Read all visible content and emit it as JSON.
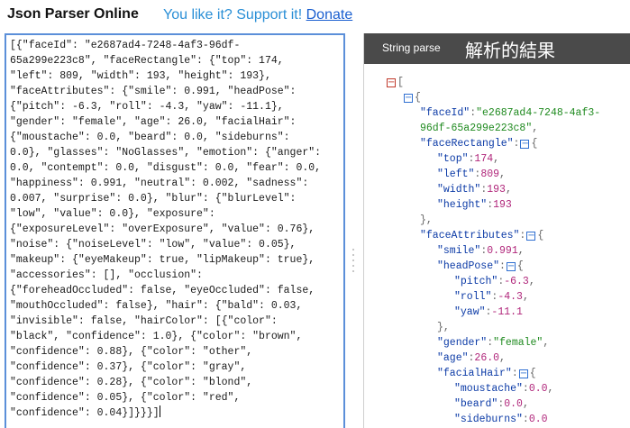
{
  "header": {
    "title": "Json Parser Online",
    "support_text": "You like it? Support it!",
    "donate_label": "Donate"
  },
  "input": {
    "lines": [
      "[{\"faceId\": \"e2687ad4-7248-4af3-96df-",
      "65a299e223c8\", \"faceRectangle\": {\"top\": 174,",
      "\"left\": 809, \"width\": 193, \"height\": 193},",
      "\"faceAttributes\": {\"smile\": 0.991, \"headPose\":",
      "{\"pitch\": -6.3, \"roll\": -4.3, \"yaw\": -11.1},",
      "\"gender\": \"female\", \"age\": 26.0, \"facialHair\":",
      "{\"moustache\": 0.0, \"beard\": 0.0, \"sideburns\":",
      "0.0}, \"glasses\": \"NoGlasses\", \"emotion\": {\"anger\":",
      "0.0, \"contempt\": 0.0, \"disgust\": 0.0, \"fear\": 0.0,",
      "\"happiness\": 0.991, \"neutral\": 0.002, \"sadness\":",
      "0.007, \"surprise\": 0.0}, \"blur\": {\"blurLevel\":",
      "\"low\", \"value\": 0.0}, \"exposure\":",
      "{\"exposureLevel\": \"overExposure\", \"value\": 0.76},",
      "\"noise\": {\"noiseLevel\": \"low\", \"value\": 0.05},",
      "\"makeup\": {\"eyeMakeup\": true, \"lipMakeup\": true},",
      "\"accessories\": [], \"occlusion\":",
      "{\"foreheadOccluded\": false, \"eyeOccluded\": false,",
      "\"mouthOccluded\": false}, \"hair\": {\"bald\": 0.03,",
      "\"invisible\": false, \"hairColor\": [{\"color\":",
      "\"black\", \"confidence\": 1.0}, {\"color\": \"brown\",",
      "\"confidence\": 0.88}, {\"color\": \"other\",",
      "\"confidence\": 0.37}, {\"color\": \"gray\",",
      "\"confidence\": 0.28}, {\"color\": \"blond\",",
      "\"confidence\": 0.05}, {\"color\": \"red\",",
      "\"confidence\": 0.04}]}}}]"
    ]
  },
  "output": {
    "tab_label": "String parse",
    "result_label": "解析的結果",
    "tree": [
      {
        "toggle": "red",
        "open": "["
      },
      {
        "toggle": "blue",
        "open": "{"
      },
      {
        "key": "faceId",
        "value": "\"e2687ad4-7248-4af3-",
        "type": "str"
      },
      {
        "cont": "96df-65a299e223c8\"",
        "type": "str",
        "trail": ","
      },
      {
        "key": "faceRectangle",
        "toggle": "blue",
        "open": "{"
      },
      {
        "key": "top",
        "value": "174",
        "type": "num",
        "trail": ","
      },
      {
        "key": "left",
        "value": "809",
        "type": "num",
        "trail": ","
      },
      {
        "key": "width",
        "value": "193",
        "type": "num",
        "trail": ","
      },
      {
        "key": "height",
        "value": "193",
        "type": "num"
      },
      {
        "close": "},"
      },
      {
        "key": "faceAttributes",
        "toggle": "blue",
        "open": "{"
      },
      {
        "key": "smile",
        "value": "0.991",
        "type": "num",
        "trail": ","
      },
      {
        "key": "headPose",
        "toggle": "blue",
        "open": "{"
      },
      {
        "key": "pitch",
        "value": "-6.3",
        "type": "num",
        "trail": ","
      },
      {
        "key": "roll",
        "value": "-4.3",
        "type": "num",
        "trail": ","
      },
      {
        "key": "yaw",
        "value": "-11.1",
        "type": "num"
      },
      {
        "close": "},"
      },
      {
        "key": "gender",
        "value": "\"female\"",
        "type": "str",
        "trail": ","
      },
      {
        "key": "age",
        "value": "26.0",
        "type": "num",
        "trail": ","
      },
      {
        "key": "facialHair",
        "toggle": "blue",
        "open": "{"
      },
      {
        "key": "moustache",
        "value": "0.0",
        "type": "num",
        "trail": ","
      },
      {
        "key": "beard",
        "value": "0.0",
        "type": "num",
        "trail": ","
      },
      {
        "key": "sideburns",
        "value": "0.0",
        "type": "num"
      }
    ]
  }
}
